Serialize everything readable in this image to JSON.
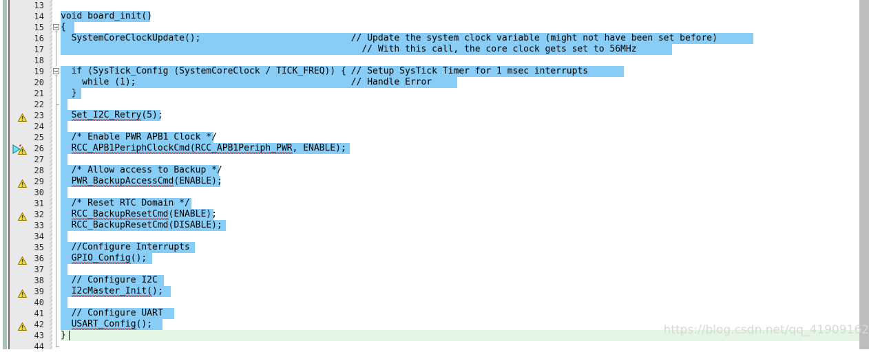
{
  "editor": {
    "name": "code-editor",
    "language": "c",
    "font_size_px": 13,
    "line_height_px": 16,
    "colors": {
      "selection": "#87cdf5",
      "current_line": "#e4f7e4",
      "gutter_bg": "#e9e9e9",
      "left_bar": "#a8c4b4",
      "right_strip": "#bdbdbd",
      "text": "#000000",
      "line_number": "#2b2b2b",
      "error_squiggle": "#ee3333",
      "warning_icon": "#f2d12e",
      "marker_arrow": "#2fd0e0",
      "watermark": "#d8d8d8"
    }
  },
  "watermark": {
    "text": "https://blog.csdn.net/qq_41909162"
  },
  "lines": [
    {
      "number": "13",
      "indent": 0,
      "text": "",
      "warning": false,
      "marker": false,
      "fold": "none",
      "selected": false,
      "current": false
    },
    {
      "number": "14",
      "indent": 0,
      "text": "void board_init()",
      "warning": false,
      "marker": false,
      "fold": "none",
      "selected": true,
      "current": false
    },
    {
      "number": "15",
      "indent": 0,
      "text": "{",
      "warning": false,
      "marker": false,
      "fold": "open",
      "selected": true,
      "current": false
    },
    {
      "number": "16",
      "indent": 2,
      "text": "SystemCoreClockUpdate();",
      "comment_col": 54,
      "comment": "// Update the system clock variable (might not have been set before)",
      "warning": false,
      "marker": false,
      "fold": "line",
      "selected": true,
      "current": false
    },
    {
      "number": "17",
      "indent": 0,
      "text": "",
      "comment_col": 56,
      "comment": "// With this call, the core clock gets set to 56MHz",
      "warning": false,
      "marker": false,
      "fold": "line",
      "selected": true,
      "current": false
    },
    {
      "number": "18",
      "indent": 0,
      "text": "",
      "warning": false,
      "marker": false,
      "fold": "line",
      "selected": true,
      "current": false
    },
    {
      "number": "19",
      "indent": 2,
      "text": "if (SysTick_Config (SystemCoreClock / TICK_FREQ)) {",
      "comment_col": 54,
      "comment": "// Setup SysTick Timer for 1 msec interrupts",
      "warning": false,
      "marker": false,
      "fold": "open",
      "selected": true,
      "current": false
    },
    {
      "number": "20",
      "indent": 4,
      "text": "while (1);",
      "comment_col": 54,
      "comment": "// Handle Error",
      "warning": false,
      "marker": false,
      "fold": "line",
      "selected": true,
      "current": false
    },
    {
      "number": "21",
      "indent": 2,
      "text": "}",
      "warning": false,
      "marker": false,
      "fold": "line",
      "selected": true,
      "current": false
    },
    {
      "number": "22",
      "indent": 0,
      "text": "",
      "warning": false,
      "marker": false,
      "fold": "tick",
      "selected": true,
      "current": false
    },
    {
      "number": "23",
      "indent": 2,
      "text": "Set_I2C_Retry(5);",
      "squiggle_end": 13,
      "warning": true,
      "marker": false,
      "fold": "line",
      "selected": true,
      "current": false
    },
    {
      "number": "24",
      "indent": 0,
      "text": "",
      "warning": false,
      "marker": false,
      "fold": "line",
      "selected": true,
      "current": false
    },
    {
      "number": "25",
      "indent": 2,
      "text": "/* Enable PWR APB1 Clock */",
      "warning": false,
      "marker": false,
      "fold": "line",
      "selected": true,
      "current": false
    },
    {
      "number": "26",
      "indent": 2,
      "text": "RCC_APB1PeriphClockCmd(RCC_APB1Periph_PWR, ENABLE);",
      "squiggle_end": 41,
      "warning": true,
      "marker": true,
      "fold": "line",
      "selected": true,
      "current": false
    },
    {
      "number": "27",
      "indent": 0,
      "text": "",
      "warning": false,
      "marker": false,
      "fold": "line",
      "selected": true,
      "current": false
    },
    {
      "number": "28",
      "indent": 2,
      "text": "/* Allow access to Backup */",
      "warning": false,
      "marker": false,
      "fold": "line",
      "selected": true,
      "current": false
    },
    {
      "number": "29",
      "indent": 2,
      "text": "PWR_BackupAccessCmd(ENABLE);",
      "squiggle_end": 19,
      "warning": true,
      "marker": false,
      "fold": "line",
      "selected": true,
      "current": false
    },
    {
      "number": "30",
      "indent": 0,
      "text": "",
      "warning": false,
      "marker": false,
      "fold": "line",
      "selected": true,
      "current": false
    },
    {
      "number": "31",
      "indent": 2,
      "text": "/* Reset RTC Domain */",
      "warning": false,
      "marker": false,
      "fold": "line",
      "selected": true,
      "current": false
    },
    {
      "number": "32",
      "indent": 2,
      "text": "RCC_BackupResetCmd(ENABLE);",
      "squiggle_end": 18,
      "warning": true,
      "marker": false,
      "fold": "line",
      "selected": true,
      "current": false
    },
    {
      "number": "33",
      "indent": 2,
      "text": "RCC_BackupResetCmd(DISABLE);",
      "warning": false,
      "marker": false,
      "fold": "line",
      "selected": true,
      "current": false
    },
    {
      "number": "34",
      "indent": 0,
      "text": "",
      "warning": false,
      "marker": false,
      "fold": "line",
      "selected": true,
      "current": false
    },
    {
      "number": "35",
      "indent": 2,
      "text": "//Configure Interrupts",
      "warning": false,
      "marker": false,
      "fold": "line",
      "selected": true,
      "current": false
    },
    {
      "number": "36",
      "indent": 2,
      "text": "GPIO_Config();",
      "squiggle_end": 11,
      "warning": true,
      "marker": false,
      "fold": "line",
      "selected": true,
      "current": false
    },
    {
      "number": "37",
      "indent": 0,
      "text": "",
      "warning": false,
      "marker": false,
      "fold": "line",
      "selected": true,
      "current": false
    },
    {
      "number": "38",
      "indent": 2,
      "text": "// Configure I2C",
      "warning": false,
      "marker": false,
      "fold": "line",
      "selected": true,
      "current": false
    },
    {
      "number": "39",
      "indent": 2,
      "text": "I2cMaster_Init();",
      "squiggle_end": 15,
      "warning": true,
      "marker": false,
      "fold": "line",
      "selected": true,
      "current": false
    },
    {
      "number": "40",
      "indent": 0,
      "text": "",
      "warning": false,
      "marker": false,
      "fold": "line",
      "selected": true,
      "current": false
    },
    {
      "number": "41",
      "indent": 2,
      "text": "// Configure UART",
      "warning": false,
      "marker": false,
      "fold": "line",
      "selected": true,
      "current": false
    },
    {
      "number": "42",
      "indent": 2,
      "text": "USART_Config();",
      "squiggle_end": 12,
      "warning": true,
      "marker": false,
      "fold": "line",
      "selected": true,
      "current": false
    },
    {
      "number": "43",
      "indent": 0,
      "text": "}",
      "warning": false,
      "marker": false,
      "fold": "line",
      "selected": false,
      "current": true,
      "cursor_col": 1
    },
    {
      "number": "44",
      "indent": 0,
      "text": "",
      "warning": false,
      "marker": false,
      "fold": "corner",
      "selected": false,
      "current": false
    }
  ],
  "selection_widths": {
    "14": 130,
    "15": 20,
    "16": 1006,
    "17": 888,
    "18": 0,
    "19": 818,
    "20": 576,
    "21": 30,
    "22": 10,
    "23": 145,
    "24": 10,
    "25": 222,
    "26": 420,
    "27": 10,
    "28": 230,
    "29": 232,
    "30": 10,
    "31": 190,
    "32": 222,
    "33": 240,
    "34": 10,
    "35": 195,
    "36": 133,
    "37": 10,
    "38": 150,
    "39": 160,
    "40": 10,
    "41": 165,
    "42": 148
  }
}
